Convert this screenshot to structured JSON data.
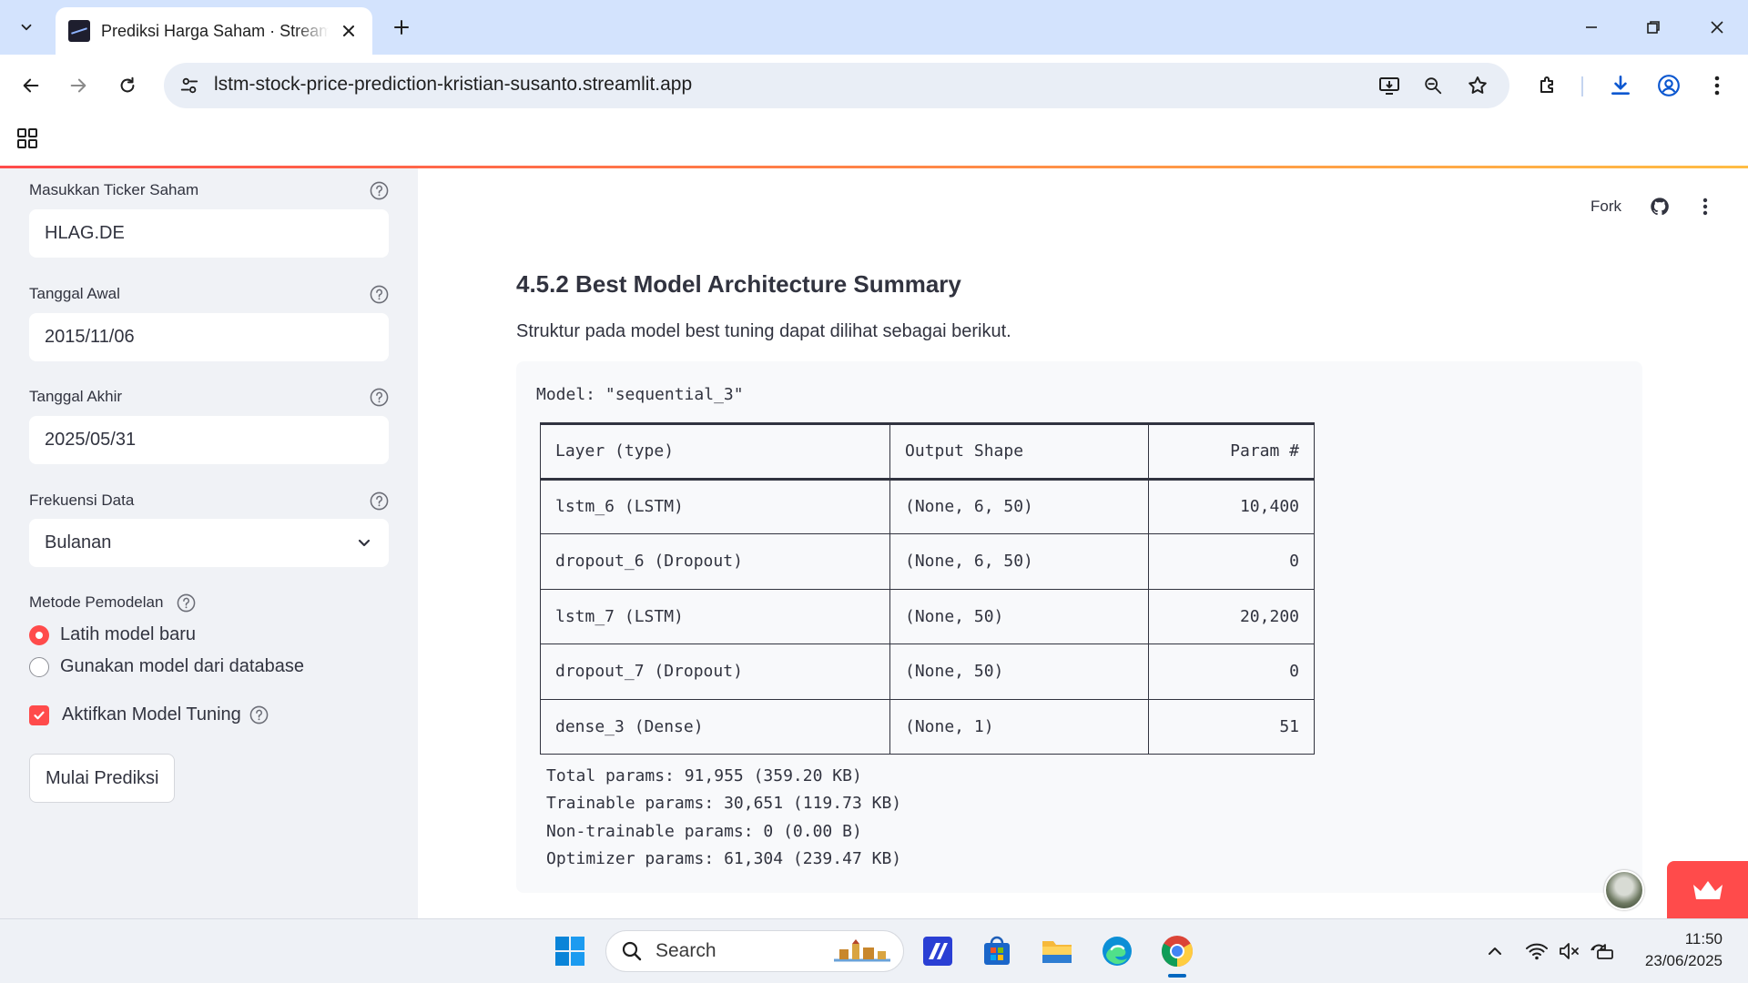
{
  "browser": {
    "tab_title": "Prediksi Harga Saham · Streamlit",
    "url": "lstm-stock-price-prediction-kristian-susanto.streamlit.app"
  },
  "sidebar": {
    "ticker": {
      "label": "Masukkan Ticker Saham",
      "value": "HLAG.DE"
    },
    "start_date": {
      "label": "Tanggal Awal",
      "value": "2015/11/06"
    },
    "end_date": {
      "label": "Tanggal Akhir",
      "value": "2025/05/31"
    },
    "frequency": {
      "label": "Frekuensi Data",
      "value": "Bulanan"
    },
    "method": {
      "label": "Metode Pemodelan",
      "options": [
        "Latih model baru",
        "Gunakan model dari database"
      ],
      "selected": "Latih model baru"
    },
    "tuning": {
      "label": "Aktifkan Model Tuning",
      "checked": true
    },
    "predict_button": "Mulai Prediksi"
  },
  "header": {
    "fork_label": "Fork"
  },
  "main": {
    "heading": "4.5.2 Best Model Architecture Summary",
    "paragraph": "Struktur pada model best tuning dapat dilihat sebagai berikut.",
    "model_line": "Model: \"sequential_3\"",
    "table": {
      "headers": [
        "Layer (type)",
        "Output Shape",
        "Param #"
      ],
      "rows": [
        [
          "lstm_6 (LSTM)",
          "(None, 6, 50)",
          "10,400"
        ],
        [
          "dropout_6 (Dropout)",
          "(None, 6, 50)",
          "0"
        ],
        [
          "lstm_7 (LSTM)",
          "(None, 50)",
          "20,200"
        ],
        [
          "dropout_7 (Dropout)",
          "(None, 50)",
          "0"
        ],
        [
          "dense_3 (Dense)",
          "(None, 1)",
          "51"
        ]
      ]
    },
    "summary": [
      "Total params: 91,955 (359.20 KB)",
      "Trainable params: 30,651 (119.73 KB)",
      "Non-trainable params: 0 (0.00 B)",
      "Optimizer params: 61,304 (239.47 KB)"
    ]
  },
  "taskbar": {
    "search_placeholder": "Search",
    "time": "11:50",
    "date": "23/06/2025"
  },
  "colors": {
    "accent": "#ff4b4b",
    "sidebar_bg": "#f0f2f6",
    "chrome_bg": "#d3e3fd"
  }
}
